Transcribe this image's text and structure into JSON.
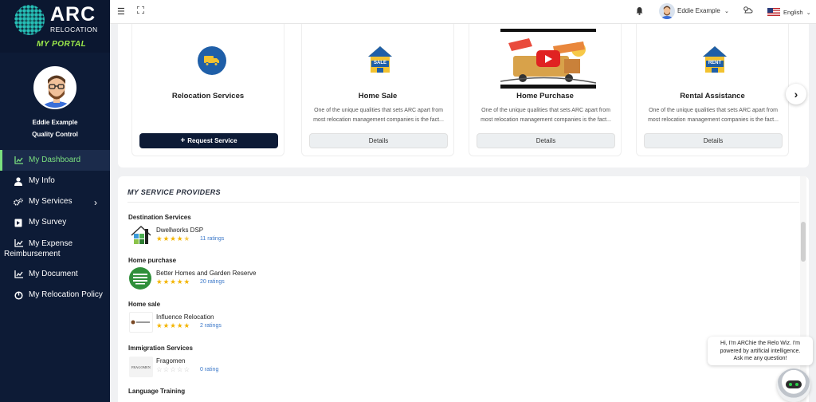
{
  "brand": {
    "name": "ARC",
    "sub": "RELOCATION",
    "portal": "MY PORTAL"
  },
  "user": {
    "name": "Eddie Example",
    "role": "Quality Control"
  },
  "nav": [
    {
      "label": "My Dashboard",
      "icon": "chart-icon",
      "active": true
    },
    {
      "label": "My Info",
      "icon": "person-icon"
    },
    {
      "label": "My Services",
      "icon": "gears-icon",
      "has_submenu": true
    },
    {
      "label": "My Survey",
      "icon": "survey-icon"
    },
    {
      "label": "My Expense",
      "label2": "Reimbursement",
      "icon": "chart-icon"
    },
    {
      "label": "My Document",
      "icon": "chart-icon"
    },
    {
      "label": "My Relocation Policy",
      "icon": "policy-icon"
    }
  ],
  "header": {
    "user_name": "Eddie Example",
    "language": "English"
  },
  "services": [
    {
      "title": "Relocation Services",
      "desc": "",
      "button": "Request Service",
      "icon": "truck-icon"
    },
    {
      "title": "Home Sale",
      "desc": "One of the unique qualities that sets ARC apart from most relocation management companies is the fact...",
      "button": "Details",
      "icon": "house-sale-icon",
      "icon_label": "SALE"
    },
    {
      "title": "Home Purchase",
      "desc": "One of the unique qualities that sets ARC apart from most relocation management companies is the fact...",
      "button": "Details",
      "icon": "video-thumbnail"
    },
    {
      "title": "Rental Assistance",
      "desc": "One of the unique qualities that sets ARC apart from most relocation management companies is the fact...",
      "button": "Details",
      "icon": "house-rent-icon",
      "icon_label": "RENT"
    }
  ],
  "providers_title": "MY SERVICE PROVIDERS",
  "providers": [
    {
      "category": "Destination Services",
      "name": "Dwellworks DSP",
      "rating": 4.5,
      "ratings_text": "11 ratings",
      "logo": "dwellworks-logo"
    },
    {
      "category": "Home purchase",
      "name": "Better Homes and Garden Reserve",
      "rating": 5,
      "ratings_text": "20 ratings",
      "logo": "bhgre-logo"
    },
    {
      "category": "Home sale",
      "name": "Influence Relocation",
      "rating": 5,
      "ratings_text": "2 ratings",
      "logo": "influence-logo"
    },
    {
      "category": "Immigration Services",
      "name": "Fragomen",
      "rating": 0,
      "ratings_text": "0 rating",
      "logo": "fragomen-logo",
      "logo_text": "FRAGOMEN"
    },
    {
      "category": "Language Training"
    }
  ],
  "chat": {
    "line1": "Hi, I'm ARChie the Relo Wiz. I'm",
    "line2": "powered by artificial intelligence.",
    "line3": "Ask me any question!"
  },
  "colors": {
    "sidebar": "#0d1b36",
    "accent_green": "#7be07f",
    "star": "#f3b400",
    "link": "#3a77c8",
    "bhgre_green": "#2f8f3a"
  }
}
